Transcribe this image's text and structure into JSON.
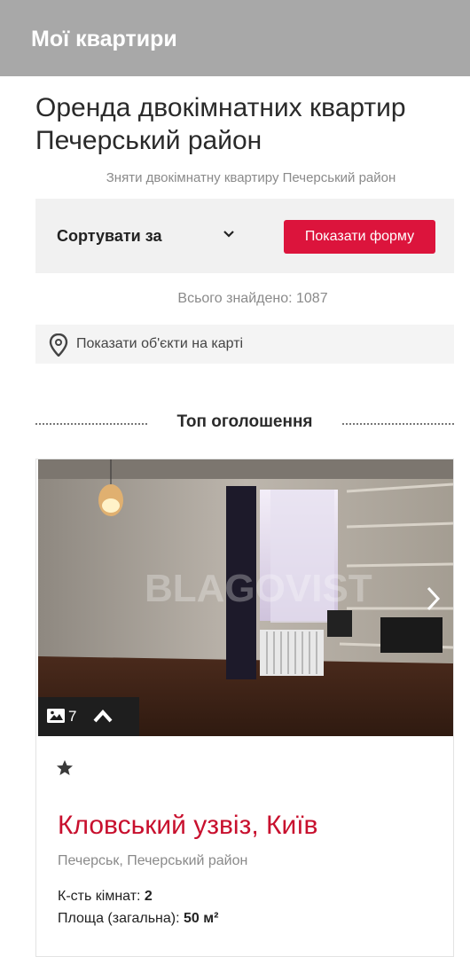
{
  "app": {
    "title": "Мої квартири"
  },
  "page": {
    "heading": "Оренда двокімнатних квартир Печерський район",
    "subheading": "Зняти двокімнатну квартиру Печерський район"
  },
  "sort": {
    "label": "Сортувати за",
    "show_form_label": "Показати форму"
  },
  "results": {
    "found_text": "Всього знайдено: 1087"
  },
  "map": {
    "label": "Показати об'єкти на карті"
  },
  "top_ads": {
    "label": "Топ оголошення"
  },
  "listing": {
    "photo_count": "7",
    "watermark": "BLAGOVIST",
    "title": "Кловський узвіз, Київ",
    "district": "Печерськ, Печерський район",
    "rooms_label": "К-сть кімнат:",
    "rooms_value": "2",
    "area_label": "Площа (загальна):",
    "area_value": "50 м²"
  },
  "colors": {
    "appbar": "#a8a8a8",
    "accent": "#dc143c",
    "listing_title": "#c8102e"
  }
}
